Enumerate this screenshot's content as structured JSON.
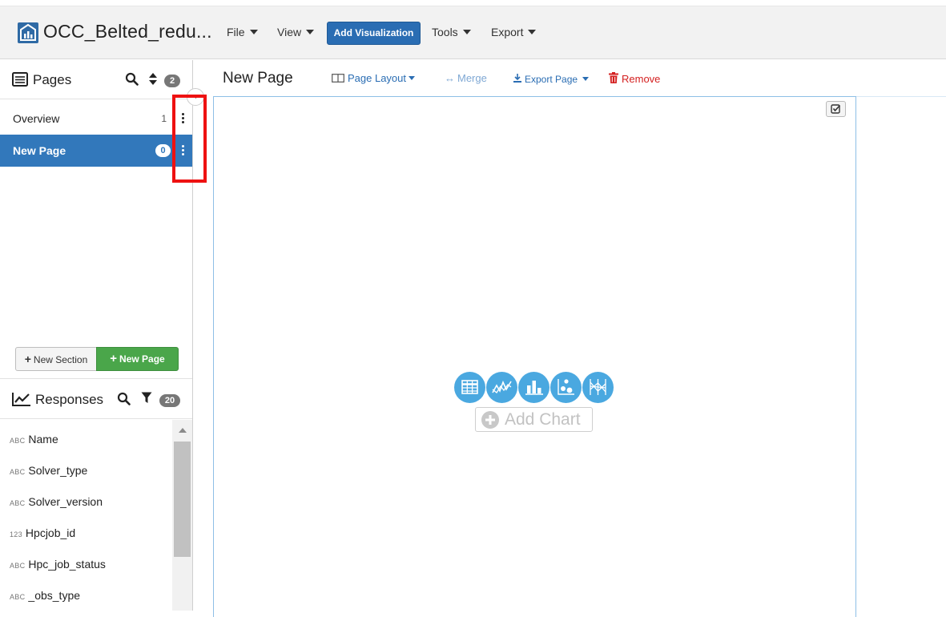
{
  "app": {
    "title": "OCC_Belted_redu..."
  },
  "menu": {
    "file": "File",
    "view": "View",
    "add_visualization": "Add Visualization",
    "tools": "Tools",
    "export": "Export"
  },
  "pages_panel": {
    "title": "Pages",
    "count": "2",
    "items": [
      {
        "label": "Overview",
        "count": "1",
        "active": false
      },
      {
        "label": "New Page",
        "count": "0",
        "active": true
      }
    ],
    "new_section": "New Section",
    "new_page": "New Page"
  },
  "responses_panel": {
    "title": "Responses",
    "count": "20",
    "fields": [
      {
        "type": "ABC",
        "name": "Name"
      },
      {
        "type": "ABC",
        "name": "Solver_type"
      },
      {
        "type": "ABC",
        "name": "Solver_version"
      },
      {
        "type": "123",
        "name": "Hpcjob_id"
      },
      {
        "type": "ABC",
        "name": "Hpc_job_status"
      },
      {
        "type": "ABC",
        "name": "_obs_type"
      }
    ]
  },
  "toolbar": {
    "page_title": "New Page",
    "page_layout": "Page Layout",
    "merge": "Merge",
    "export_page": "Export Page",
    "remove": "Remove"
  },
  "canvas": {
    "add_chart": "Add Chart",
    "chart_types": [
      "table-icon",
      "line-chart-icon",
      "bar-chart-icon",
      "scatter-chart-icon",
      "parallel-coordinates-icon"
    ]
  },
  "colors": {
    "accent": "#3278bb",
    "button_primary": "#2a6db3",
    "success": "#4aa64a",
    "danger": "#d42020",
    "chart_icon": "#4aa8e0",
    "highlight": "#ee1111"
  }
}
